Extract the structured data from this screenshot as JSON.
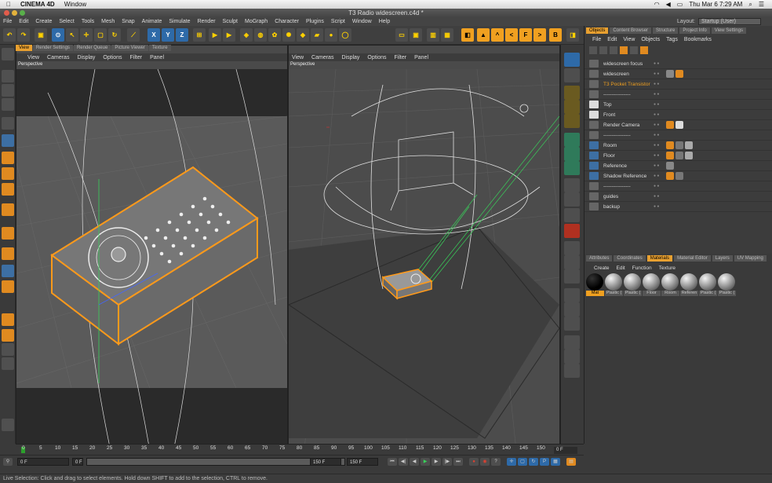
{
  "mac_menu": {
    "app_name": "CINEMA 4D",
    "window_menu": "Window",
    "clock": "Thu Mar 6  7:29 AM"
  },
  "window_title": "T3 Radio widescreen.c4d *",
  "main_menu": [
    "File",
    "Edit",
    "Create",
    "Select",
    "Tools",
    "Mesh",
    "Snap",
    "Animate",
    "Simulate",
    "Render",
    "Sculpt",
    "MoGraph",
    "Character",
    "Plugins",
    "Script",
    "Window",
    "Help"
  ],
  "layout": {
    "label": "Layout:",
    "value": "Startup (User)"
  },
  "left_tabs": [
    "View",
    "Render Settings",
    "Render Queue",
    "Picture Viewer",
    "Texture"
  ],
  "viewport_menu": [
    "View",
    "Cameras",
    "Display",
    "Options",
    "Filter",
    "Panel"
  ],
  "viewport_left": {
    "label": "Perspective"
  },
  "viewport_right": {
    "label": "Perspective"
  },
  "toolbar_axes": [
    "X",
    "Y",
    "Z"
  ],
  "toolbar_right": [
    "F",
    "B"
  ],
  "object_tabs": [
    "Objects",
    "Content Browser",
    "Structure",
    "Project Info",
    "View Settings"
  ],
  "object_menu": [
    "File",
    "Edit",
    "View",
    "Objects",
    "Tags",
    "Bookmarks"
  ],
  "objects": [
    {
      "name": "widescreen focus",
      "highlight": false
    },
    {
      "name": "widescreen",
      "highlight": false
    },
    {
      "name": "T3 Pocket Transistor",
      "highlight": true
    },
    {
      "name": "----------------",
      "highlight": false
    },
    {
      "name": "Top",
      "highlight": false
    },
    {
      "name": "Front",
      "highlight": false
    },
    {
      "name": "Render Camera",
      "highlight": false
    },
    {
      "name": "----------------",
      "highlight": false
    },
    {
      "name": "Room",
      "highlight": false
    },
    {
      "name": "Floor",
      "highlight": false
    },
    {
      "name": "Reference",
      "highlight": false
    },
    {
      "name": "Shadow Reference",
      "highlight": false
    },
    {
      "name": "----------------",
      "highlight": false
    },
    {
      "name": "guides",
      "highlight": false
    },
    {
      "name": "backup",
      "highlight": false
    }
  ],
  "material_tabs": [
    "Attributes",
    "Coordinates",
    "Materials",
    "Material Editor",
    "Layers",
    "UV Mapping"
  ],
  "material_menu": [
    "Create",
    "Edit",
    "Function",
    "Texture"
  ],
  "materials": [
    "Mat",
    "Plastic (",
    "Plastic (",
    "Floor",
    "Room",
    "Referen",
    "Plastic (",
    "Plastic ("
  ],
  "timeline": {
    "ticks": [
      "0",
      "5",
      "10",
      "15",
      "20",
      "25",
      "30",
      "35",
      "40",
      "45",
      "50",
      "55",
      "60",
      "65",
      "70",
      "75",
      "80",
      "85",
      "90",
      "95",
      "100",
      "105",
      "110",
      "115",
      "120",
      "125",
      "130",
      "135",
      "140",
      "145",
      "150"
    ],
    "current_frame": "0 F"
  },
  "playback": {
    "start": "0 F",
    "min": "0 F",
    "max": "150 F",
    "end": "150 F"
  },
  "status": "Live Selection: Click and drag to select elements. Hold down SHIFT to add to the selection, CTRL to remove.",
  "colors": {
    "accent": "#f0a020",
    "selection": "#ff9a1a",
    "guide_green": "#39d05a"
  }
}
